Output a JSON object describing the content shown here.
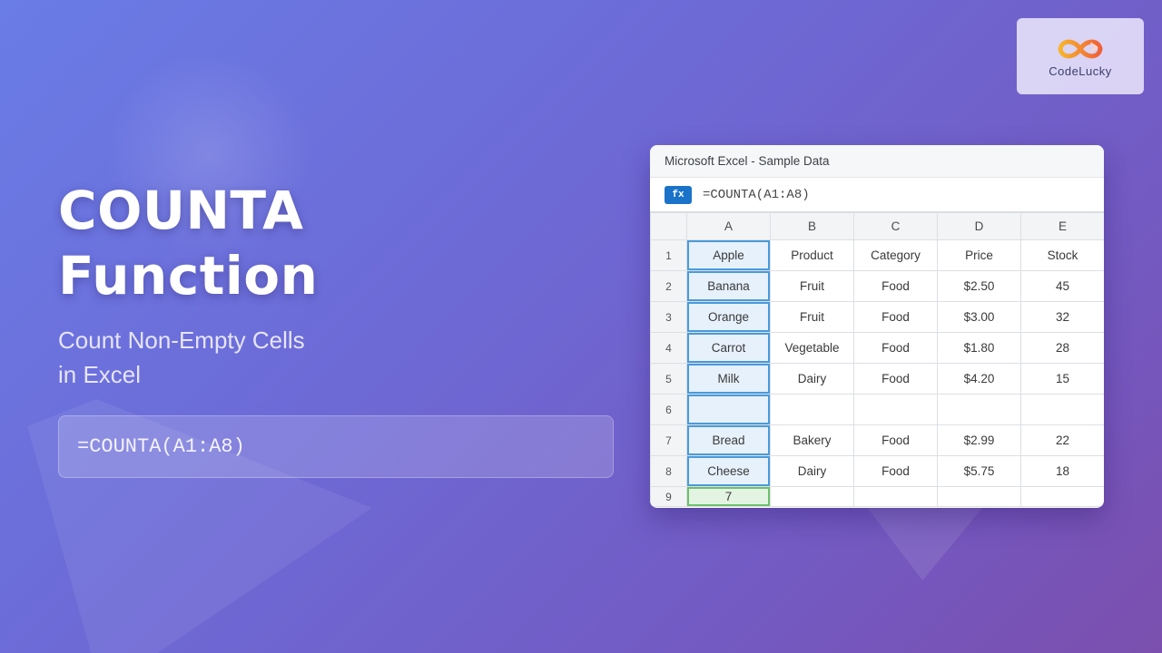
{
  "hero": {
    "title_line1": "COUNTA",
    "title_line2": "Function",
    "subtitle_line1": "Count Non-Empty Cells",
    "subtitle_line2": "in Excel",
    "formula": "=COUNTA(A1:A8)"
  },
  "logo": {
    "text": "CodeLucky",
    "icon": "infinity-logo-icon"
  },
  "excel": {
    "title": "Microsoft Excel - Sample Data",
    "fx_label": "fx",
    "formula": "=COUNTA(A1:A8)",
    "columns": [
      "A",
      "B",
      "C",
      "D",
      "E"
    ],
    "rows": [
      {
        "num": "1",
        "cells": [
          "Apple",
          "Product",
          "Category",
          "Price",
          "Stock"
        ]
      },
      {
        "num": "2",
        "cells": [
          "Banana",
          "Fruit",
          "Food",
          "$2.50",
          "45"
        ]
      },
      {
        "num": "3",
        "cells": [
          "Orange",
          "Fruit",
          "Food",
          "$3.00",
          "32"
        ]
      },
      {
        "num": "4",
        "cells": [
          "Carrot",
          "Vegetable",
          "Food",
          "$1.80",
          "28"
        ]
      },
      {
        "num": "5",
        "cells": [
          "Milk",
          "Dairy",
          "Food",
          "$4.20",
          "15"
        ]
      },
      {
        "num": "6",
        "cells": [
          "",
          "",
          "",
          "",
          ""
        ]
      },
      {
        "num": "7",
        "cells": [
          "Bread",
          "Bakery",
          "Food",
          "$2.99",
          "22"
        ]
      },
      {
        "num": "8",
        "cells": [
          "Cheese",
          "Dairy",
          "Food",
          "$5.75",
          "18"
        ]
      },
      {
        "num": "9",
        "cells": [
          "7",
          "",
          "",
          "",
          ""
        ]
      }
    ]
  },
  "colors": {
    "accent_blue": "#1a73c8",
    "selection_blue": "#4a9ad9",
    "result_green": "#2a7a2e"
  }
}
